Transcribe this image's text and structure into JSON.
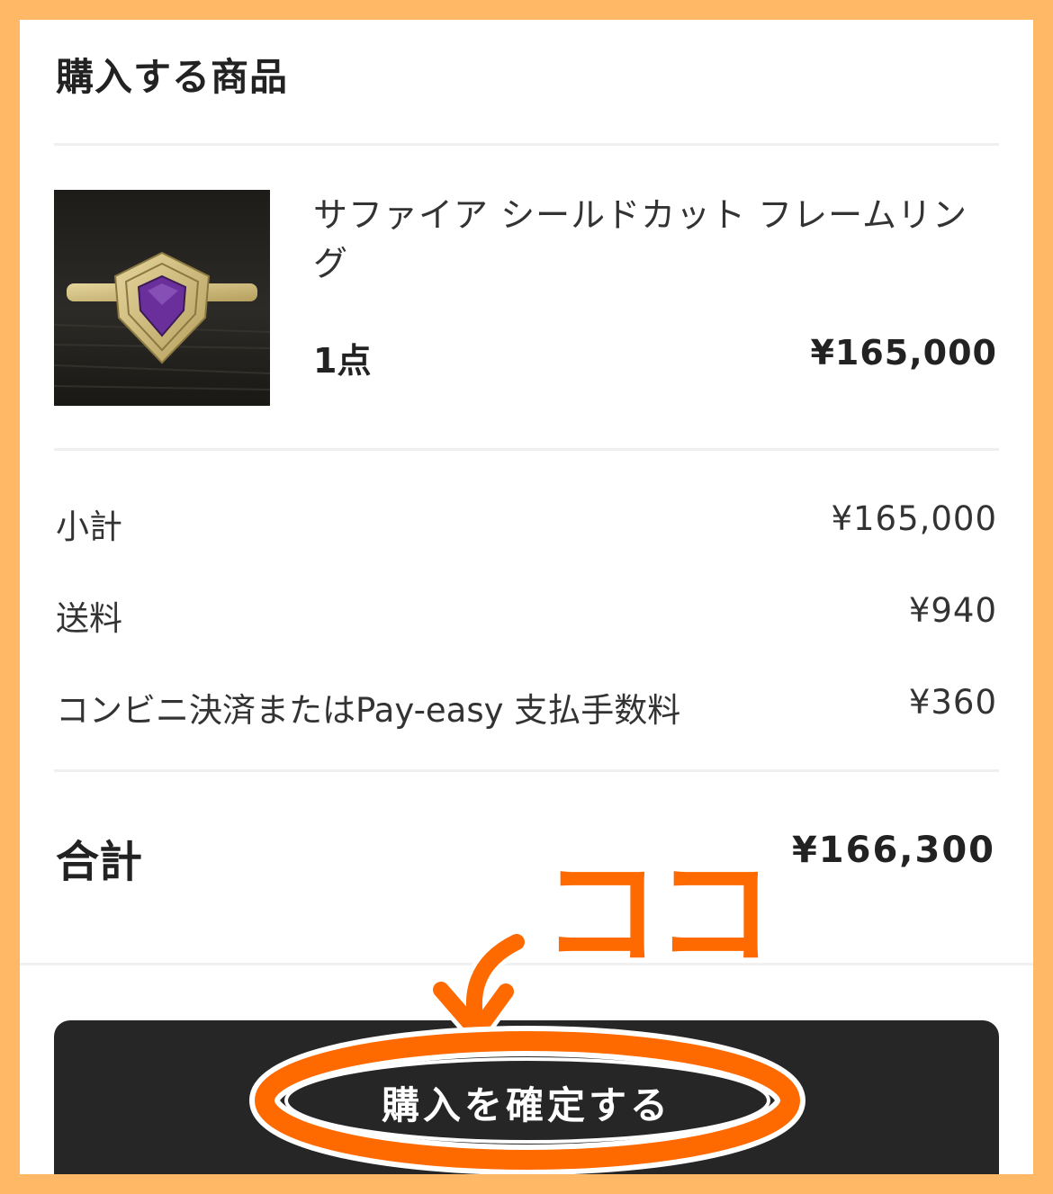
{
  "section_title": "購入する商品",
  "product": {
    "name": "サファイア シールドカット フレームリング",
    "quantity": "1点",
    "price": "¥165,000",
    "image": "ring-with-purple-sapphire"
  },
  "summary": {
    "rows": [
      {
        "label": "小計",
        "value": "¥165,000"
      },
      {
        "label": "送料",
        "value": "¥940"
      },
      {
        "label": "コンビニ決済またはPay-easy 支払手数料",
        "value": "¥360"
      }
    ],
    "total_label": "合計",
    "total_value": "¥166,300"
  },
  "confirm_button": {
    "label": "購入を確定する"
  },
  "annotation": {
    "text": "ココ",
    "color": "#ff6a00",
    "shapes": [
      "curved-arrow",
      "highlight-ellipse"
    ]
  },
  "colors": {
    "frame": "#ffb865",
    "button": "#262626",
    "annotation": "#ff6a00"
  }
}
